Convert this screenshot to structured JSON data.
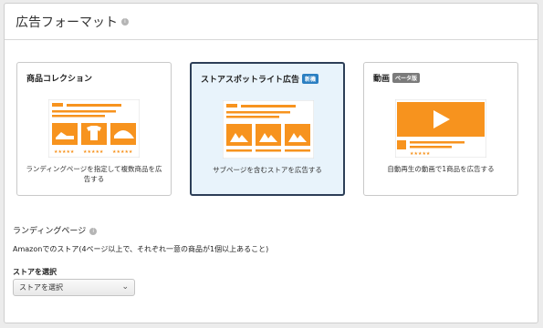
{
  "header": {
    "title": "広告フォーマット"
  },
  "formats": [
    {
      "label": "商品コレクション",
      "badge": "",
      "description": "ランディングページを指定して複数商品を広告する"
    },
    {
      "label": "ストアスポットライト広告",
      "badge": "新機",
      "description": "サブページを含むストアを広告する"
    },
    {
      "label": "動画",
      "badge": "ベータ版",
      "description": "自動再生の動画で1商品を広告する"
    }
  ],
  "landing": {
    "label": "ランディングページ",
    "description": "Amazonでのストア(4ページ以上で、それぞれ一意の商品が1個以上あること)"
  },
  "store": {
    "label": "ストアを選択",
    "selected": "ストアを選択"
  },
  "colors": {
    "accent": "#f7931e",
    "selected_border": "#2c3e57",
    "new_badge": "#2b7fc2"
  }
}
